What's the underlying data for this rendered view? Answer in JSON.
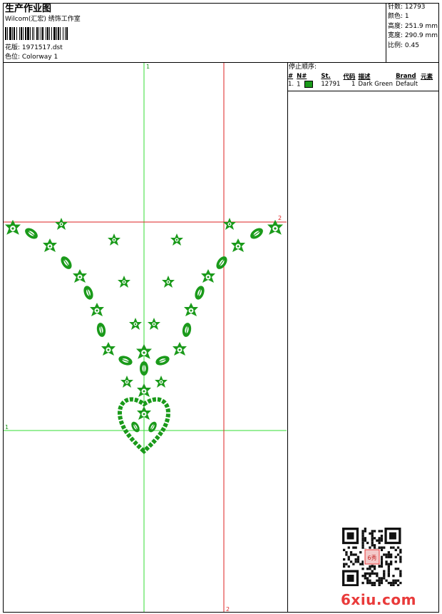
{
  "header": {
    "title": "生产作业图",
    "company": "Wilcom(汇宏) 绣饰工作室",
    "design_file": "花版: 1971517.dst",
    "colorway": "色位:  Colorway 1"
  },
  "info": {
    "stitches": "针数: 12793",
    "colors": "颜色: 1",
    "height": "高度: 251.9 mm",
    "width": "宽度: 290.9 mm",
    "scale": "比例: 0.45"
  },
  "stop_sequence": {
    "title": "停止顺序:",
    "columns": [
      "#",
      "N#",
      "St.",
      "代码",
      "描述",
      "Brand",
      "元素"
    ],
    "rows": [
      {
        "num": "1.",
        "needle": "1",
        "stitches": "12791",
        "code": "1",
        "description": "Dark Green",
        "brand": "Default",
        "element": ""
      }
    ]
  },
  "guides": {
    "h1_label": "1",
    "h2_label": "2",
    "v1_label": "1",
    "v2_label": "2"
  },
  "colors": {
    "thread": "#1a9a1a",
    "guide_green": "#33dd33",
    "guide_red": "#dd2222"
  },
  "watermark": {
    "text": "6xiu.com",
    "stamp": "6秀"
  }
}
